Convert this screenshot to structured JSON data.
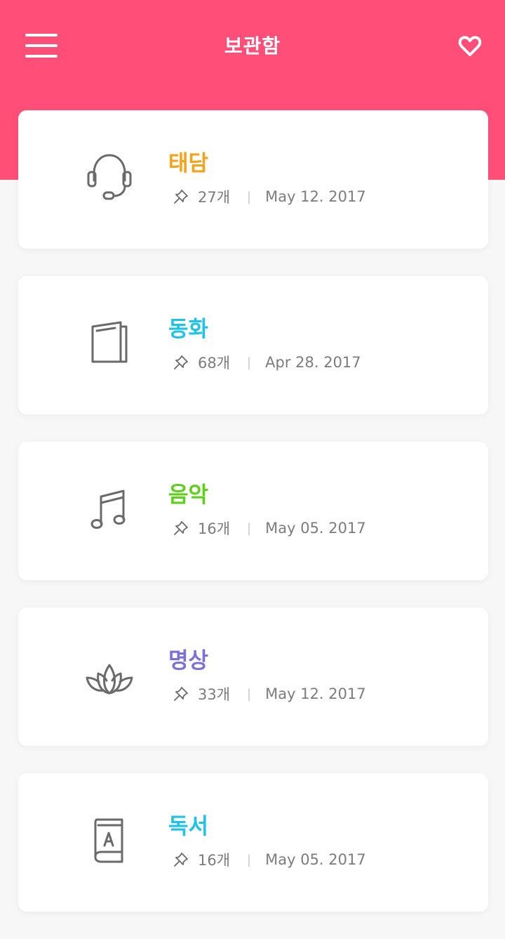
{
  "header": {
    "title": "보관함",
    "menu_icon": "hamburger-menu-icon",
    "favorite_icon": "heart-icon",
    "color": "#ff4f78"
  },
  "items": [
    {
      "title": "태담",
      "count": "27개",
      "date": "May 12. 2017",
      "icon": "headset-icon",
      "color": "#f5a21b"
    },
    {
      "title": "동화",
      "count": "68개",
      "date": "Apr 28. 2017",
      "icon": "book-icon",
      "color": "#1fc3ea"
    },
    {
      "title": "음악",
      "count": "16개",
      "date": "May 05. 2017",
      "icon": "music-note-icon",
      "color": "#5ecf1a"
    },
    {
      "title": "명상",
      "count": "33개",
      "date": "May 12. 2017",
      "icon": "lotus-icon",
      "color": "#7b6fdc"
    },
    {
      "title": "독서",
      "count": "16개",
      "date": "May 05. 2017",
      "icon": "reading-book-icon",
      "color": "#1fc3ea"
    }
  ]
}
